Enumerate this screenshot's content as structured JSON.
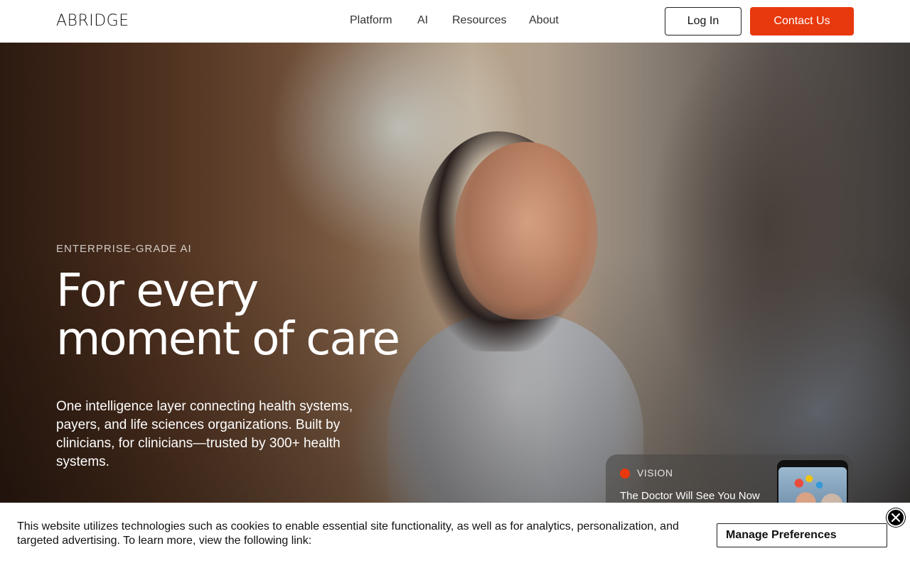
{
  "header": {
    "logo": "ABRIDGE",
    "nav": [
      {
        "label": "Platform"
      },
      {
        "label": "AI"
      },
      {
        "label": "Resources"
      },
      {
        "label": "About"
      }
    ],
    "login_label": "Log In",
    "contact_label": "Contact Us"
  },
  "hero": {
    "eyebrow": "ENTERPRISE-GRADE AI",
    "headline_line1": "For every",
    "headline_line2": "moment of care",
    "subtext": "One intelligence layer connecting health systems, payers, and life sciences organizations. Built by clinicians, for clinicians—trusted by 300+ health systems."
  },
  "vision_card": {
    "tag": "VISION",
    "title": "The Doctor Will See You Now"
  },
  "cookie_banner": {
    "text": "This website utilizes technologies such as cookies to enable essential site functionality, as well as for analytics, personalization, and targeted advertising. To learn more, view the following link:",
    "manage_label": "Manage Preferences"
  },
  "colors": {
    "accent": "#e8380d",
    "text_dark": "#111111"
  }
}
